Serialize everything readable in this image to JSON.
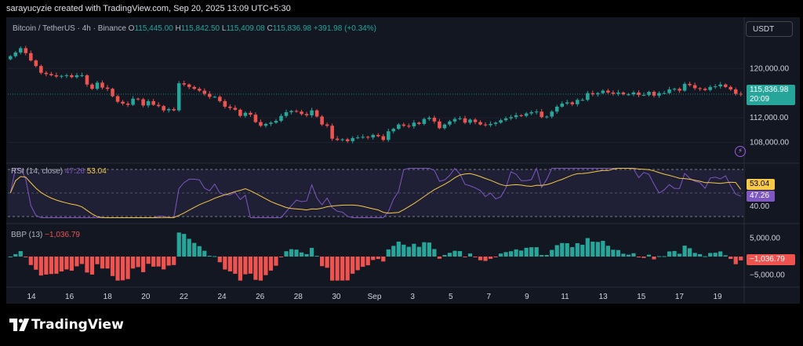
{
  "header": {
    "credit": "sarayucyzie created with TradingView.com, Sep 20, 2025 13:09 UTC+5:30"
  },
  "legend": {
    "symbol": "Bitcoin / TetherUS · 4h · Binance",
    "o_label": "O",
    "o_value": "115,445.00",
    "h_label": "H",
    "h_value": "115,842.50",
    "l_label": "L",
    "l_value": "115,409.08",
    "c_label": "C",
    "c_value": "115,836.98",
    "change": "+391.98 (+0.34%)"
  },
  "currency_button": "USDT",
  "price_tag": {
    "price": "115,836.98",
    "countdown": "20:09"
  },
  "rsi": {
    "name": "RSI (14, close)",
    "value": "47.26",
    "ma_value": "53.04",
    "axis_label": "40.00",
    "color_rsi": "#7e57c2",
    "color_ma": "#f7c948"
  },
  "bbp": {
    "name": "BBP (13)",
    "value": "−1,036.79",
    "axis_top": "5,000.00",
    "axis_bottom": "−5,000.00",
    "color_up": "#26a69a",
    "color_down": "#ef5350"
  },
  "price_axis": [
    "120,000.00",
    "112,000.00",
    "108,000.00"
  ],
  "brand": "TradingView",
  "colors": {
    "up": "#26a69a",
    "down": "#ef5350",
    "background": "#131722"
  },
  "chart_data": {
    "type": "candlestick",
    "interval": "4h",
    "x_tick_labels": [
      "14",
      "16",
      "18",
      "20",
      "22",
      "24",
      "26",
      "28",
      "30",
      "Sep",
      "3",
      "5",
      "7",
      "9",
      "11",
      "13",
      "15",
      "17",
      "19"
    ],
    "y_ticks": [
      120000,
      112000,
      108000
    ],
    "ylim": [
      105000,
      124500
    ],
    "close_approx": [
      122000,
      122600,
      123300,
      122500,
      121300,
      120400,
      119300,
      119100,
      118900,
      118700,
      118800,
      118900,
      118600,
      118900,
      118900,
      117400,
      116700,
      117700,
      116900,
      116700,
      115500,
      114600,
      114300,
      114100,
      115100,
      115000,
      114000,
      114700,
      114100,
      113900,
      113200,
      113400,
      113200,
      117600,
      117400,
      117000,
      116700,
      116400,
      115900,
      115400,
      115400,
      114700,
      113800,
      113600,
      113300,
      112300,
      112800,
      112500,
      111300,
      110700,
      111000,
      111200,
      111500,
      112300,
      112900,
      113100,
      113000,
      112600,
      112400,
      113200,
      112200,
      110900,
      110700,
      108600,
      108400,
      108500,
      108200,
      108700,
      108800,
      108900,
      108800,
      109200,
      109000,
      108400,
      109800,
      110200,
      110900,
      110700,
      110600,
      111200,
      111000,
      111800,
      112000,
      111400,
      110300,
      110900,
      111400,
      111800,
      111900,
      111200,
      111700,
      111300,
      110900,
      110800,
      111000,
      111200,
      111600,
      111900,
      112100,
      112400,
      112300,
      112700,
      112900,
      113000,
      112100,
      112200,
      113000,
      113800,
      114300,
      114500,
      114200,
      114900,
      114900,
      116000,
      115800,
      116000,
      116400,
      116100,
      115900,
      116100,
      115800,
      115800,
      116100,
      115700,
      115700,
      116200,
      115600,
      116000,
      116000,
      116600,
      116700,
      116400,
      117500,
      117300,
      116800,
      116700,
      116500,
      117000,
      117100,
      117400,
      117000,
      116600,
      115900,
      115837
    ],
    "rsi_series": {
      "name": "RSI (14, close)",
      "last": 47.26,
      "ma_last": 53.04,
      "band": [
        30,
        70
      ]
    },
    "bbp_series": {
      "name": "BBP (13)",
      "last": -1036.79,
      "ylim": [
        -7000,
        7000
      ]
    }
  }
}
